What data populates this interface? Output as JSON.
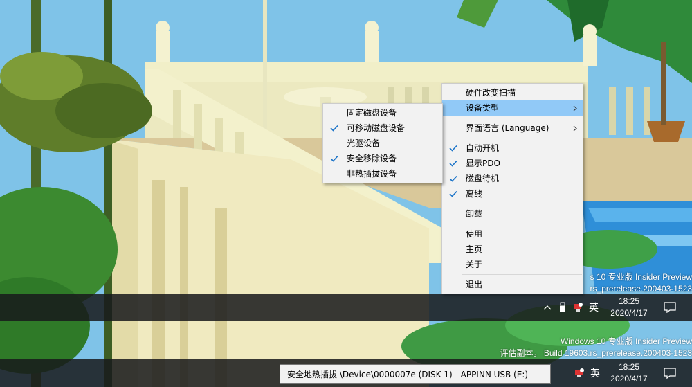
{
  "colors": {
    "sky": "#7fc3e8",
    "menu_bg": "#f2f2f2",
    "menu_highlight": "#91c9f7",
    "check_mark": "#1a73c8",
    "taskbar": "#181a1c"
  },
  "main_menu": {
    "items": [
      {
        "label": "硬件改变扫描",
        "checked": false,
        "submenu": false,
        "highlighted": false
      },
      {
        "label": "设备类型",
        "checked": false,
        "submenu": true,
        "highlighted": true
      },
      {
        "label": "界面语言 (Language)",
        "checked": false,
        "submenu": true,
        "highlighted": false
      },
      {
        "label": "自动开机",
        "checked": true,
        "submenu": false,
        "highlighted": false
      },
      {
        "label": "显示PDO",
        "checked": true,
        "submenu": false,
        "highlighted": false
      },
      {
        "label": "磁盘待机",
        "checked": true,
        "submenu": false,
        "highlighted": false
      },
      {
        "label": "离线",
        "checked": true,
        "submenu": false,
        "highlighted": false
      },
      {
        "label": "卸载",
        "checked": false,
        "submenu": false,
        "highlighted": false
      },
      {
        "label": "使用",
        "checked": false,
        "submenu": false,
        "highlighted": false
      },
      {
        "label": "主页",
        "checked": false,
        "submenu": false,
        "highlighted": false
      },
      {
        "label": "关于",
        "checked": false,
        "submenu": false,
        "highlighted": false
      },
      {
        "label": "退出",
        "checked": false,
        "submenu": false,
        "highlighted": false
      }
    ]
  },
  "device_type_submenu": {
    "items": [
      {
        "label": "固定磁盘设备",
        "checked": false
      },
      {
        "label": "可移动磁盘设备",
        "checked": true
      },
      {
        "label": "光驱设备",
        "checked": false
      },
      {
        "label": "安全移除设备",
        "checked": true
      },
      {
        "label": "非热插拔设备",
        "checked": false
      }
    ]
  },
  "watermark_top": {
    "line1": "s 10 专业版 Insider Preview",
    "line2": "rs_prerelease.200403-1523"
  },
  "watermark_bottom": {
    "line1": "Windows 10 专业版 Insider Preview",
    "line2": "评估副本。 Build 19603.rs_prerelease.200403-1523"
  },
  "taskbar_top": {
    "lang": "英",
    "time": "18:25",
    "date": "2020/4/17"
  },
  "taskbar_bottom": {
    "lang": "英",
    "time": "18:25",
    "date": "2020/4/17"
  },
  "tooltip": {
    "text": "安全地热插拔 \\Device\\0000007e (DISK 1) - APPINN USB (E:)"
  },
  "icons": {
    "tray_chevron": "chevron-up-icon",
    "tray_usb": "usb-drive-icon",
    "tray_app": "hotswap-app-icon",
    "notification": "notification-icon",
    "check": "check-icon",
    "submenu_arrow": "chevron-right-icon"
  }
}
